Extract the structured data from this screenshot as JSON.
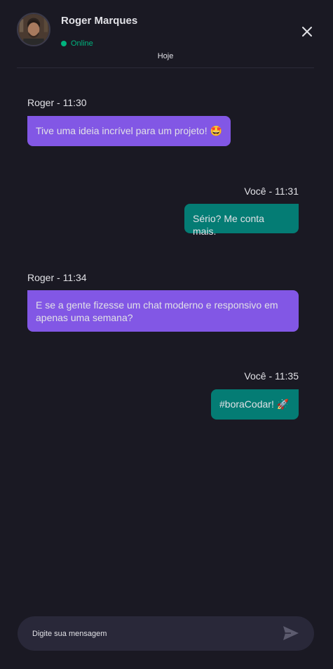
{
  "contact": {
    "name": "Roger Marques",
    "status": "Online"
  },
  "date_separator": "Hoje",
  "messages": [
    {
      "meta": "Roger - 11:30",
      "text": "Tive uma ideia incrível para um projeto! 🤩",
      "direction": "in"
    },
    {
      "meta": "Você - 11:31",
      "text": "Sério? Me conta mais.",
      "direction": "out"
    },
    {
      "meta": "Roger - 11:34",
      "text": "E se a gente fizesse um chat moderno e responsivo em apenas uma semana?",
      "direction": "in"
    },
    {
      "meta": "Você - 11:35",
      "text": "#boraCodar! 🚀",
      "direction": "out"
    }
  ],
  "composer": {
    "placeholder": "Digite sua mensagem"
  },
  "colors": {
    "background": "#1a1923",
    "incoming_bubble": "#8257e5",
    "outgoing_bubble": "#047c74",
    "online": "#00b37e",
    "composer": "#292839"
  },
  "icons": {
    "close": "close-icon",
    "send": "send-icon",
    "status": "online-dot-icon"
  }
}
